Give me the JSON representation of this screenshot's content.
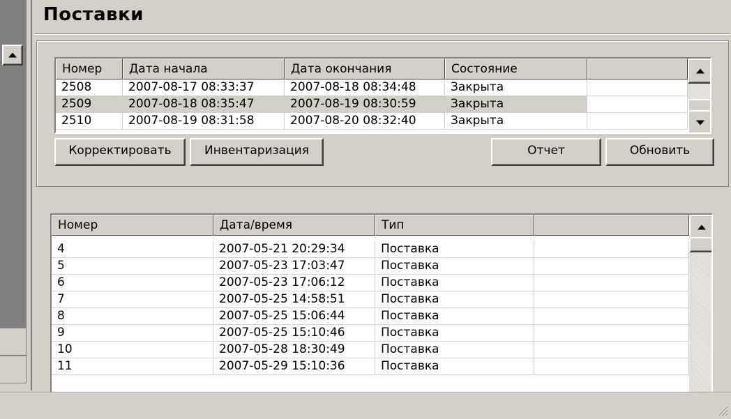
{
  "window": {
    "title": "Поставки"
  },
  "icons": {
    "scroll_up": "scroll-up-arrow-icon",
    "scroll_down": "scroll-down-arrow-icon",
    "size_grip": "size-grip-icon"
  },
  "top_grid": {
    "columns": [
      "Номер",
      "Дата начала",
      "Дата окончания",
      "Состояние",
      ""
    ],
    "rows": [
      {
        "number": "2508",
        "start": "2007-08-17 08:33:37",
        "end": "2007-08-18 08:34:48",
        "state": "Закрыта",
        "selected": false
      },
      {
        "number": "2509",
        "start": "2007-08-18 08:35:47",
        "end": "2007-08-19 08:30:59",
        "state": "Закрыта",
        "selected": true
      },
      {
        "number": "2510",
        "start": "2007-08-19 08:31:58",
        "end": "2007-08-20 08:32:40",
        "state": "Закрыта",
        "selected": false
      }
    ]
  },
  "buttons": {
    "edit": "Корректировать",
    "inventory": "Инвентаризация",
    "report": "Отчет",
    "refresh": "Обновить"
  },
  "bottom_grid": {
    "columns": [
      "Номер",
      "Дата/время",
      "Тип",
      ""
    ],
    "rows": [
      {
        "number": "4",
        "datetime": "2007-05-21 20:29:34",
        "type": "Поставка"
      },
      {
        "number": "5",
        "datetime": "2007-05-23 17:03:47",
        "type": "Поставка"
      },
      {
        "number": "6",
        "datetime": "2007-05-23 17:06:12",
        "type": "Поставка"
      },
      {
        "number": "7",
        "datetime": "2007-05-25 14:58:51",
        "type": "Поставка"
      },
      {
        "number": "8",
        "datetime": "2007-05-25 15:06:44",
        "type": "Поставка"
      },
      {
        "number": "9",
        "datetime": "2007-05-25 15:10:46",
        "type": "Поставка"
      },
      {
        "number": "10",
        "datetime": "2007-05-28 18:30:49",
        "type": "Поставка"
      },
      {
        "number": "11",
        "datetime": "2007-05-29 15:10:36",
        "type": "Поставка"
      }
    ]
  }
}
